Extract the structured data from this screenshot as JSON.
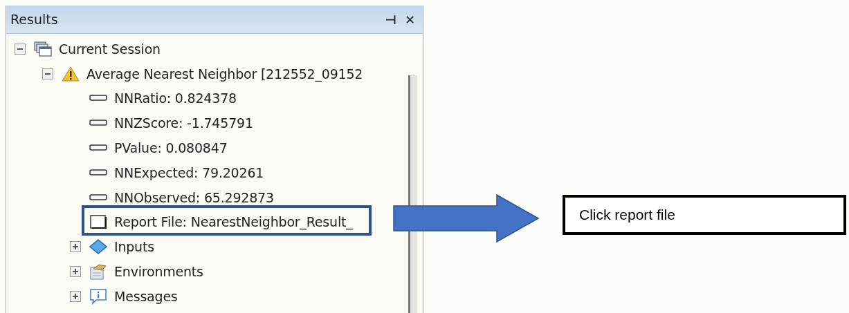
{
  "panel": {
    "title": "Results",
    "pin": "⊣",
    "close": "✕"
  },
  "tree": [
    {
      "kind": "session",
      "label": "Current Session",
      "expanded": true,
      "children": [
        {
          "kind": "warning",
          "label": "Average Nearest Neighbor [212552_09152",
          "expanded": true,
          "children": [
            {
              "kind": "value",
              "label": "NNRatio: 0.824378"
            },
            {
              "kind": "value",
              "label": "NNZScore: -1.745791"
            },
            {
              "kind": "value",
              "label": "PValue: 0.080847"
            },
            {
              "kind": "value",
              "label": "NNExpected: 79.20261"
            },
            {
              "kind": "value",
              "label": "NNObserved: 65.292873"
            },
            {
              "kind": "report",
              "label": "Report File: NearestNeighbor_Result_"
            },
            {
              "kind": "inputs",
              "label": "Inputs",
              "expanded": false
            },
            {
              "kind": "environments",
              "label": "Environments",
              "expanded": false
            },
            {
              "kind": "messages",
              "label": "Messages",
              "expanded": false
            }
          ]
        }
      ]
    }
  ],
  "callout": {
    "text": "Click report file"
  }
}
